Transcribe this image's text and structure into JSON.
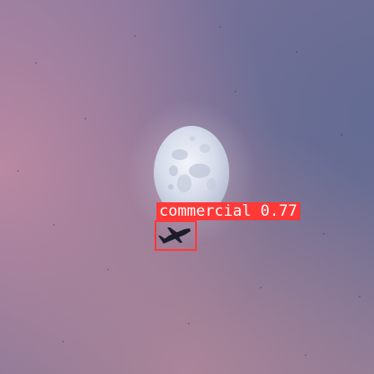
{
  "detection": {
    "class_name": "commercial",
    "confidence": "0.77",
    "box_color": "#ff3838",
    "label_text_color": "#ffffff"
  },
  "scene": {
    "subjects": [
      "sky",
      "moon",
      "airplane"
    ],
    "sky_colors": [
      "#a57f9e",
      "#7c7497",
      "#6c6f93",
      "#b7849a"
    ],
    "moon_color": "#d9e0ee"
  }
}
